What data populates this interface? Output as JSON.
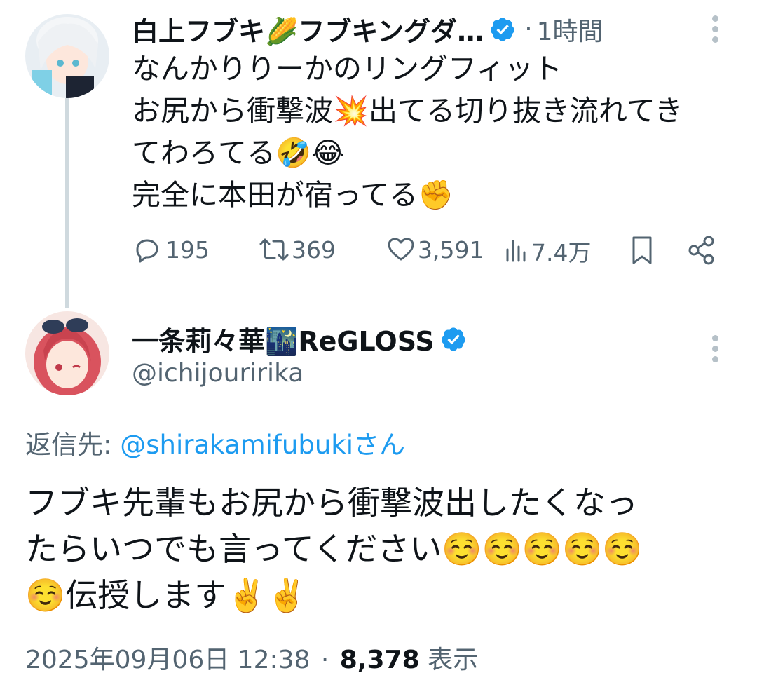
{
  "tweet1": {
    "author": "白上フブキ🌽フブキングダ…",
    "separator": "·",
    "time": "1時間",
    "lines": [
      "なんかりりーかのリングフィット",
      "お尻から衝撃波💥出てる切り抜き流れてき",
      "てわろてる🤣😂",
      "完全に本田が宿ってる✊"
    ],
    "stats": {
      "replies": "195",
      "retweets": "369",
      "likes": "3,591",
      "views": "7.4万"
    }
  },
  "tweet2": {
    "author": "一条莉々華🌃ReGLOSS",
    "handle": "@ichijouririka",
    "reply_label": "返信先:",
    "reply_mention": "@shirakamifubukiさん",
    "lines": [
      "フブキ先輩もお尻から衝撃波出したくなっ",
      "たらいつでも言ってください☺️☺️☺️☺️☺️",
      "☺️伝授します✌️✌️"
    ],
    "date": "2025年09月06日 12:38",
    "separator": "·",
    "views_count": "8,378",
    "views_label": "表示"
  },
  "colors": {
    "verified": "#1d9bf0",
    "mention": "#1d9bf0",
    "secondary_text": "#536471",
    "thread_line": "#cfd9de"
  },
  "icons": [
    "verified-badge-icon",
    "more-icon",
    "reply-icon",
    "retweet-icon",
    "like-icon",
    "views-icon",
    "bookmark-icon",
    "share-icon"
  ]
}
